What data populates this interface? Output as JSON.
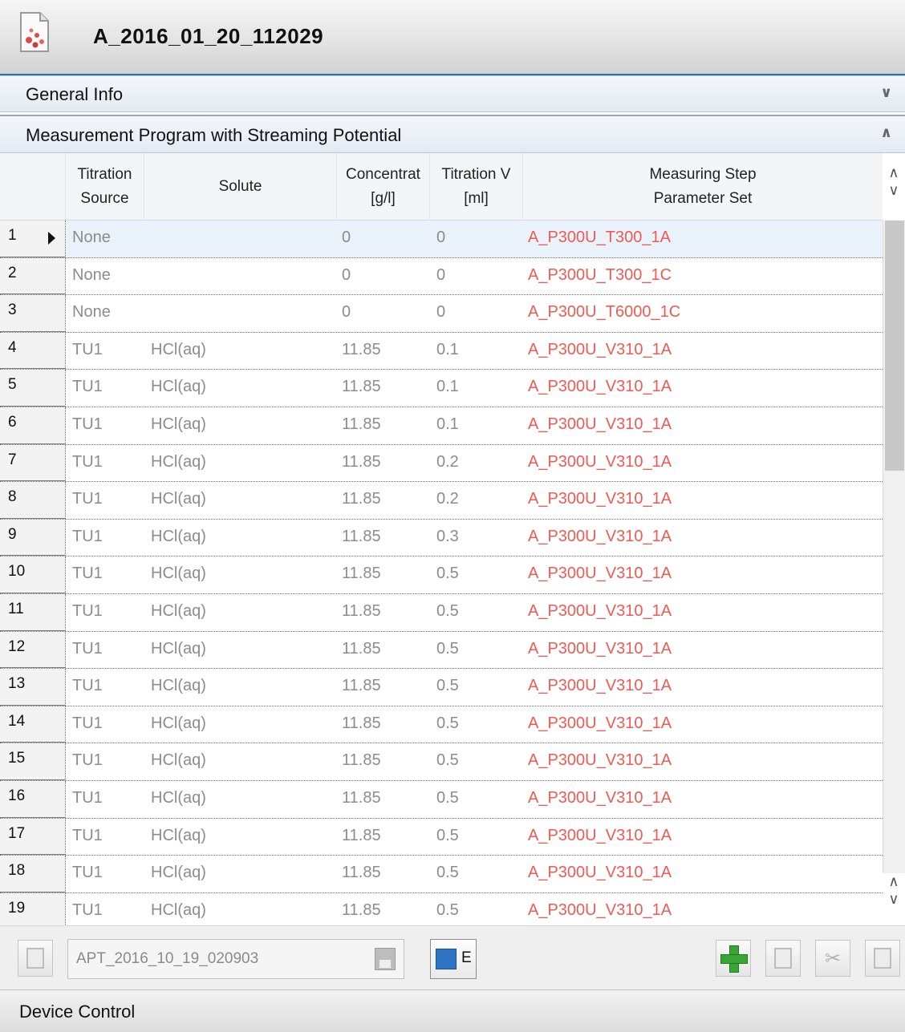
{
  "window": {
    "title": "A_2016_01_20_112029"
  },
  "sections": {
    "general": {
      "label": "General Info",
      "chevron": "double-chevron-down"
    },
    "measurement": {
      "label": "Measurement Program with Streaming Potential",
      "chevron": "double-chevron-up"
    },
    "device": {
      "label": "Device Control"
    }
  },
  "table": {
    "headers": [
      {
        "line1": "Titration",
        "line2": "Source"
      },
      {
        "line1": "Solute",
        "line2": ""
      },
      {
        "line1": "Concentrat",
        "line2": "[g/l]"
      },
      {
        "line1": "Titration V",
        "line2": "[ml]"
      },
      {
        "line1": "Measuring Step",
        "line2": "Parameter Set"
      }
    ],
    "selected_row": 1,
    "rows": [
      {
        "num": "1",
        "source": "None",
        "solute": "",
        "conc": "0",
        "vol": "0",
        "param": "A_P300U_T300_1A"
      },
      {
        "num": "2",
        "source": "None",
        "solute": "",
        "conc": "0",
        "vol": "0",
        "param": "A_P300U_T300_1C"
      },
      {
        "num": "3",
        "source": "None",
        "solute": "",
        "conc": "0",
        "vol": "0",
        "param": "A_P300U_T6000_1C"
      },
      {
        "num": "4",
        "source": "TU1",
        "solute": "HCl(aq)",
        "conc": "11.85",
        "vol": "0.1",
        "param": "A_P300U_V310_1A"
      },
      {
        "num": "5",
        "source": "TU1",
        "solute": "HCl(aq)",
        "conc": "11.85",
        "vol": "0.1",
        "param": "A_P300U_V310_1A"
      },
      {
        "num": "6",
        "source": "TU1",
        "solute": "HCl(aq)",
        "conc": "11.85",
        "vol": "0.1",
        "param": "A_P300U_V310_1A"
      },
      {
        "num": "7",
        "source": "TU1",
        "solute": "HCl(aq)",
        "conc": "11.85",
        "vol": "0.2",
        "param": "A_P300U_V310_1A"
      },
      {
        "num": "8",
        "source": "TU1",
        "solute": "HCl(aq)",
        "conc": "11.85",
        "vol": "0.2",
        "param": "A_P300U_V310_1A"
      },
      {
        "num": "9",
        "source": "TU1",
        "solute": "HCl(aq)",
        "conc": "11.85",
        "vol": "0.3",
        "param": "A_P300U_V310_1A"
      },
      {
        "num": "10",
        "source": "TU1",
        "solute": "HCl(aq)",
        "conc": "11.85",
        "vol": "0.5",
        "param": "A_P300U_V310_1A"
      },
      {
        "num": "11",
        "source": "TU1",
        "solute": "HCl(aq)",
        "conc": "11.85",
        "vol": "0.5",
        "param": "A_P300U_V310_1A"
      },
      {
        "num": "12",
        "source": "TU1",
        "solute": "HCl(aq)",
        "conc": "11.85",
        "vol": "0.5",
        "param": "A_P300U_V310_1A"
      },
      {
        "num": "13",
        "source": "TU1",
        "solute": "HCl(aq)",
        "conc": "11.85",
        "vol": "0.5",
        "param": "A_P300U_V310_1A"
      },
      {
        "num": "14",
        "source": "TU1",
        "solute": "HCl(aq)",
        "conc": "11.85",
        "vol": "0.5",
        "param": "A_P300U_V310_1A"
      },
      {
        "num": "15",
        "source": "TU1",
        "solute": "HCl(aq)",
        "conc": "11.85",
        "vol": "0.5",
        "param": "A_P300U_V310_1A"
      },
      {
        "num": "16",
        "source": "TU1",
        "solute": "HCl(aq)",
        "conc": "11.85",
        "vol": "0.5",
        "param": "A_P300U_V310_1A"
      },
      {
        "num": "17",
        "source": "TU1",
        "solute": "HCl(aq)",
        "conc": "11.85",
        "vol": "0.5",
        "param": "A_P300U_V310_1A"
      },
      {
        "num": "18",
        "source": "TU1",
        "solute": "HCl(aq)",
        "conc": "11.85",
        "vol": "0.5",
        "param": "A_P300U_V310_1A"
      },
      {
        "num": "19",
        "source": "TU1",
        "solute": "HCl(aq)",
        "conc": "11.85",
        "vol": "0.5",
        "param": "A_P300U_V310_1A"
      }
    ]
  },
  "toolbar": {
    "filename": "APT_2016_10_19_020903",
    "export_label": "E",
    "icons": [
      "load-icon",
      "save-icon",
      "export-icon",
      "add-icon",
      "copy-icon",
      "cut-icon",
      "paste-icon"
    ]
  },
  "colors": {
    "accent": "#2a6fb8",
    "param_text": "#ef5a52",
    "muted_text": "#8c8c8c",
    "add_green": "#37a637"
  }
}
